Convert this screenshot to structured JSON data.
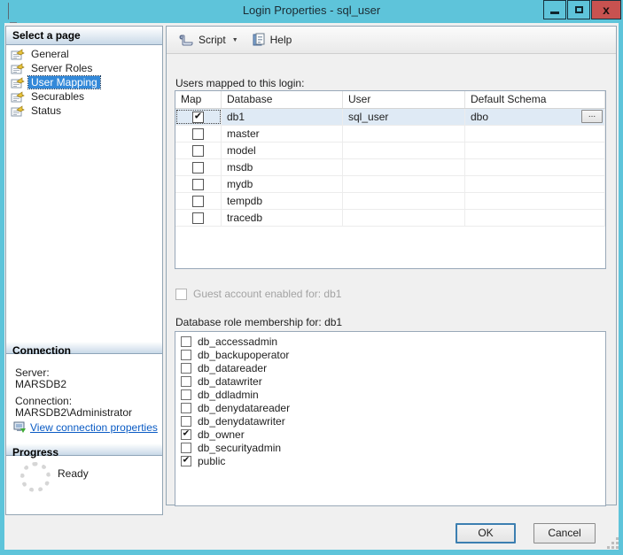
{
  "window": {
    "title": "Login Properties - sql_user",
    "controls": {
      "close_glyph": "x"
    }
  },
  "colors": {
    "titlebar": "#5ec4da",
    "close_button": "#c85250",
    "selection_blue": "#3389d9",
    "selected_row": "#dfeaf5",
    "link": "#0a5bc4"
  },
  "icons": {
    "checkmark": "✔",
    "dropdown_arrow": "▼",
    "ellipsis": "..."
  },
  "sidebar": {
    "header": "Select a page",
    "pages": [
      {
        "label": "General",
        "selected": false
      },
      {
        "label": "Server Roles",
        "selected": false
      },
      {
        "label": "User Mapping",
        "selected": true
      },
      {
        "label": "Securables",
        "selected": false
      },
      {
        "label": "Status",
        "selected": false
      }
    ],
    "connection": {
      "header": "Connection",
      "server_label": "Server:",
      "server_value": "MARSDB2",
      "connection_label": "Connection:",
      "connection_value": "MARSDB2\\Administrator",
      "link_label": "View connection properties"
    },
    "progress": {
      "header": "Progress",
      "status": "Ready"
    }
  },
  "toolbar": {
    "script_label": "Script",
    "help_label": "Help"
  },
  "main": {
    "mapping_label": "Users mapped to this login:",
    "table": {
      "columns": [
        "Map",
        "Database",
        "User",
        "Default Schema"
      ],
      "rows": [
        {
          "map_checked": true,
          "database": "db1",
          "user": "sql_user",
          "default_schema": "dbo",
          "selected": true,
          "has_ellipsis": true
        },
        {
          "map_checked": false,
          "database": "master",
          "user": "",
          "default_schema": "",
          "selected": false,
          "has_ellipsis": false
        },
        {
          "map_checked": false,
          "database": "model",
          "user": "",
          "default_schema": "",
          "selected": false,
          "has_ellipsis": false
        },
        {
          "map_checked": false,
          "database": "msdb",
          "user": "",
          "default_schema": "",
          "selected": false,
          "has_ellipsis": false
        },
        {
          "map_checked": false,
          "database": "mydb",
          "user": "",
          "default_schema": "",
          "selected": false,
          "has_ellipsis": false
        },
        {
          "map_checked": false,
          "database": "tempdb",
          "user": "",
          "default_schema": "",
          "selected": false,
          "has_ellipsis": false
        },
        {
          "map_checked": false,
          "database": "tracedb",
          "user": "",
          "default_schema": "",
          "selected": false,
          "has_ellipsis": false
        }
      ]
    },
    "guest_label": "Guest account enabled for: db1",
    "guest_checked": false,
    "role_label": "Database role membership for: db1",
    "roles": [
      {
        "name": "db_accessadmin",
        "checked": false
      },
      {
        "name": "db_backupoperator",
        "checked": false
      },
      {
        "name": "db_datareader",
        "checked": false
      },
      {
        "name": "db_datawriter",
        "checked": false
      },
      {
        "name": "db_ddladmin",
        "checked": false
      },
      {
        "name": "db_denydatareader",
        "checked": false
      },
      {
        "name": "db_denydatawriter",
        "checked": false
      },
      {
        "name": "db_owner",
        "checked": true
      },
      {
        "name": "db_securityadmin",
        "checked": false
      },
      {
        "name": "public",
        "checked": true
      }
    ]
  },
  "footer": {
    "ok_label": "OK",
    "cancel_label": "Cancel"
  }
}
